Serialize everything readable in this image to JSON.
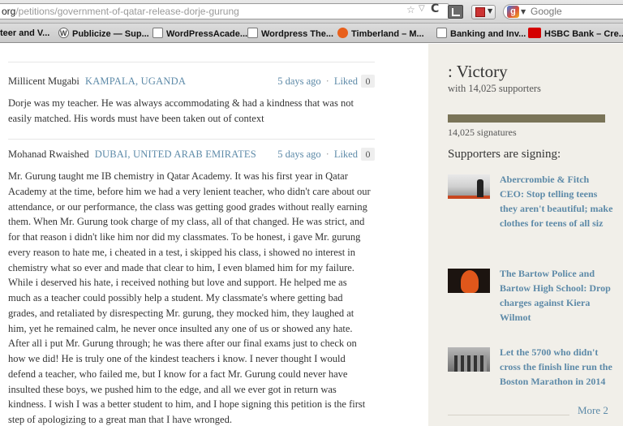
{
  "browser": {
    "url_domain": "org",
    "url_path": "/petitions/government-of-qatar-release-dorje-gurung",
    "search_placeholder": "Google",
    "bookmarks": [
      {
        "label": "teer and V...",
        "icon": "none"
      },
      {
        "label": "Publicize — Sup...",
        "icon": "wordpress-icon"
      },
      {
        "label": "WordPressAcade...",
        "icon": "document-icon"
      },
      {
        "label": "Wordpress The...",
        "icon": "document-icon"
      },
      {
        "label": "Timberland – M...",
        "icon": "timberland-icon"
      },
      {
        "label": "Banking and Inv...",
        "icon": "document-icon"
      },
      {
        "label": "HSBC Bank – Cre...",
        "icon": "hsbc-icon"
      }
    ]
  },
  "signatures": [
    {
      "name": "Millicent Mugabi",
      "location": "KAMPALA, UGANDA",
      "date": "5 days ago",
      "liked_label": "Liked",
      "like_count": "0",
      "comment_lines": [
        "Dorje was my teacher. He was always accommodating & had a kindness that was not",
        "easily matched. His words must have been taken out of context"
      ]
    },
    {
      "name": "Mohanad Rwaished",
      "location": "DUBAI, UNITED ARAB EMIRATES",
      "date": "5 days ago",
      "liked_label": "Liked",
      "like_count": "0",
      "comment_lines": [
        "Mr. Gurung taught me IB chemistry in Qatar Academy. It was his first year in Qatar",
        "Academy at the time, before him we had a very lenient teacher, who didn't care about our",
        "attendance, or our performance, the class was getting good grades without really earning",
        "them. When Mr. Gurung took charge of my class, all of that changed. He was strict, and",
        "for that reason i didn't like him nor did my classmates. To be honest, i gave Mr. gurung",
        "every reason to hate me, i cheated in a test, i skipped his class, i showed no interest in",
        "chemistry what so ever and made that clear to him, I even blamed him for my failure.",
        "While i deserved his hate, i received nothing but love and support. He helped me as",
        "much as a teacher could possibly help a student. My classmate's where getting bad",
        "grades, and retaliated by disrespecting Mr. gurung, they mocked him, they laughed at",
        "him, yet he remained calm, he never once insulted any one of us or showed any hate.",
        "After all i put Mr. Gurung through; he was there after our final exams just to check on",
        "how we did! He is truly one of the kindest teachers i know. I never thought I would",
        "defend a teacher, who failed me, but I know for a fact Mr. Gurung could never have",
        "insulted these boys, we pushed him to the edge, and all we ever got in return was",
        "kindness. I wish I was a better student to him, and I hope signing this petition is the first",
        "step of apologizing to a great man that I have wronged."
      ]
    }
  ],
  "sidebar": {
    "status": ": Victory",
    "supporters_text": "with 14,025 supporters",
    "progress_fraction": 1.0,
    "signatures_text": "14,025 signatures",
    "heading": "Supporters are signing:",
    "petitions": [
      {
        "title": "Abercrombie & Fitch CEO: Stop telling teens they aren't beautiful; make clothes for teens of all siz"
      },
      {
        "title": "The Bartow Police and Bartow High School: Drop charges against Kiera Wilmot"
      },
      {
        "title": "Let the 5700 who didn't cross the finish line run the Boston Marathon in 2014"
      }
    ],
    "more_label": "More 2"
  },
  "colors": {
    "link": "#5d8aa8",
    "sidebar_bg": "#f1efe9",
    "progress_fill": "#7a7458"
  }
}
